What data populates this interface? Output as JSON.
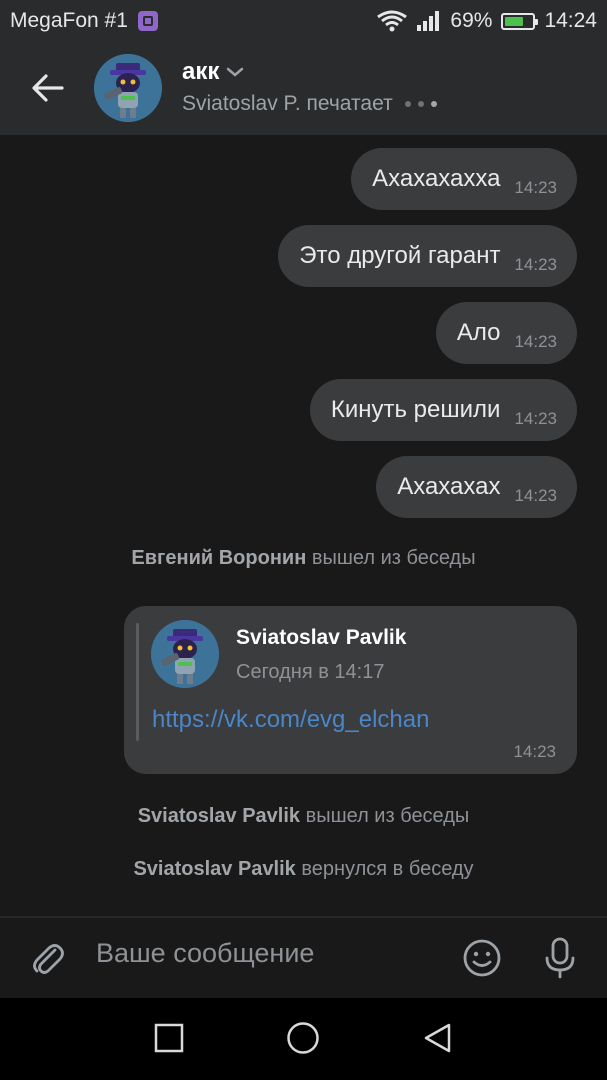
{
  "status_bar": {
    "carrier": "MegaFon #1",
    "battery": "69%",
    "time": "14:24"
  },
  "header": {
    "title": "акк",
    "subtitle": "Sviatoslav P. печатает"
  },
  "messages": [
    {
      "text": "Ахахахахха",
      "time": "14:23"
    },
    {
      "text": "Это другой гарант",
      "time": "14:23"
    },
    {
      "text": "Ало",
      "time": "14:23"
    },
    {
      "text": "Кинуть решили",
      "time": "14:23"
    },
    {
      "text": "Ахахахах",
      "time": "14:23"
    }
  ],
  "service_1": {
    "name": "Евгений Воронин",
    "action": "вышел из беседы"
  },
  "forwarded": {
    "author": "Sviatoslav Pavlik",
    "date": "Сегодня в 14:17",
    "link": "https://vk.com/evg_elchan",
    "time": "14:23"
  },
  "service_2": {
    "name": "Sviatoslav Pavlik",
    "action": "вышел из беседы"
  },
  "service_3": {
    "name": "Sviatoslav Pavlik",
    "action": "вернулся в беседу"
  },
  "composer": {
    "placeholder": "Ваше сообщение"
  },
  "icons": {
    "back": "arrow-left-icon",
    "attach": "paperclip-icon",
    "emoji": "smile-icon",
    "mic": "microphone-icon"
  },
  "colors": {
    "background": "#19191a",
    "bar": "#2a2b2c",
    "bubble": "#3b3c3e",
    "link": "#4a86c8",
    "battery": "#4cc24c"
  }
}
